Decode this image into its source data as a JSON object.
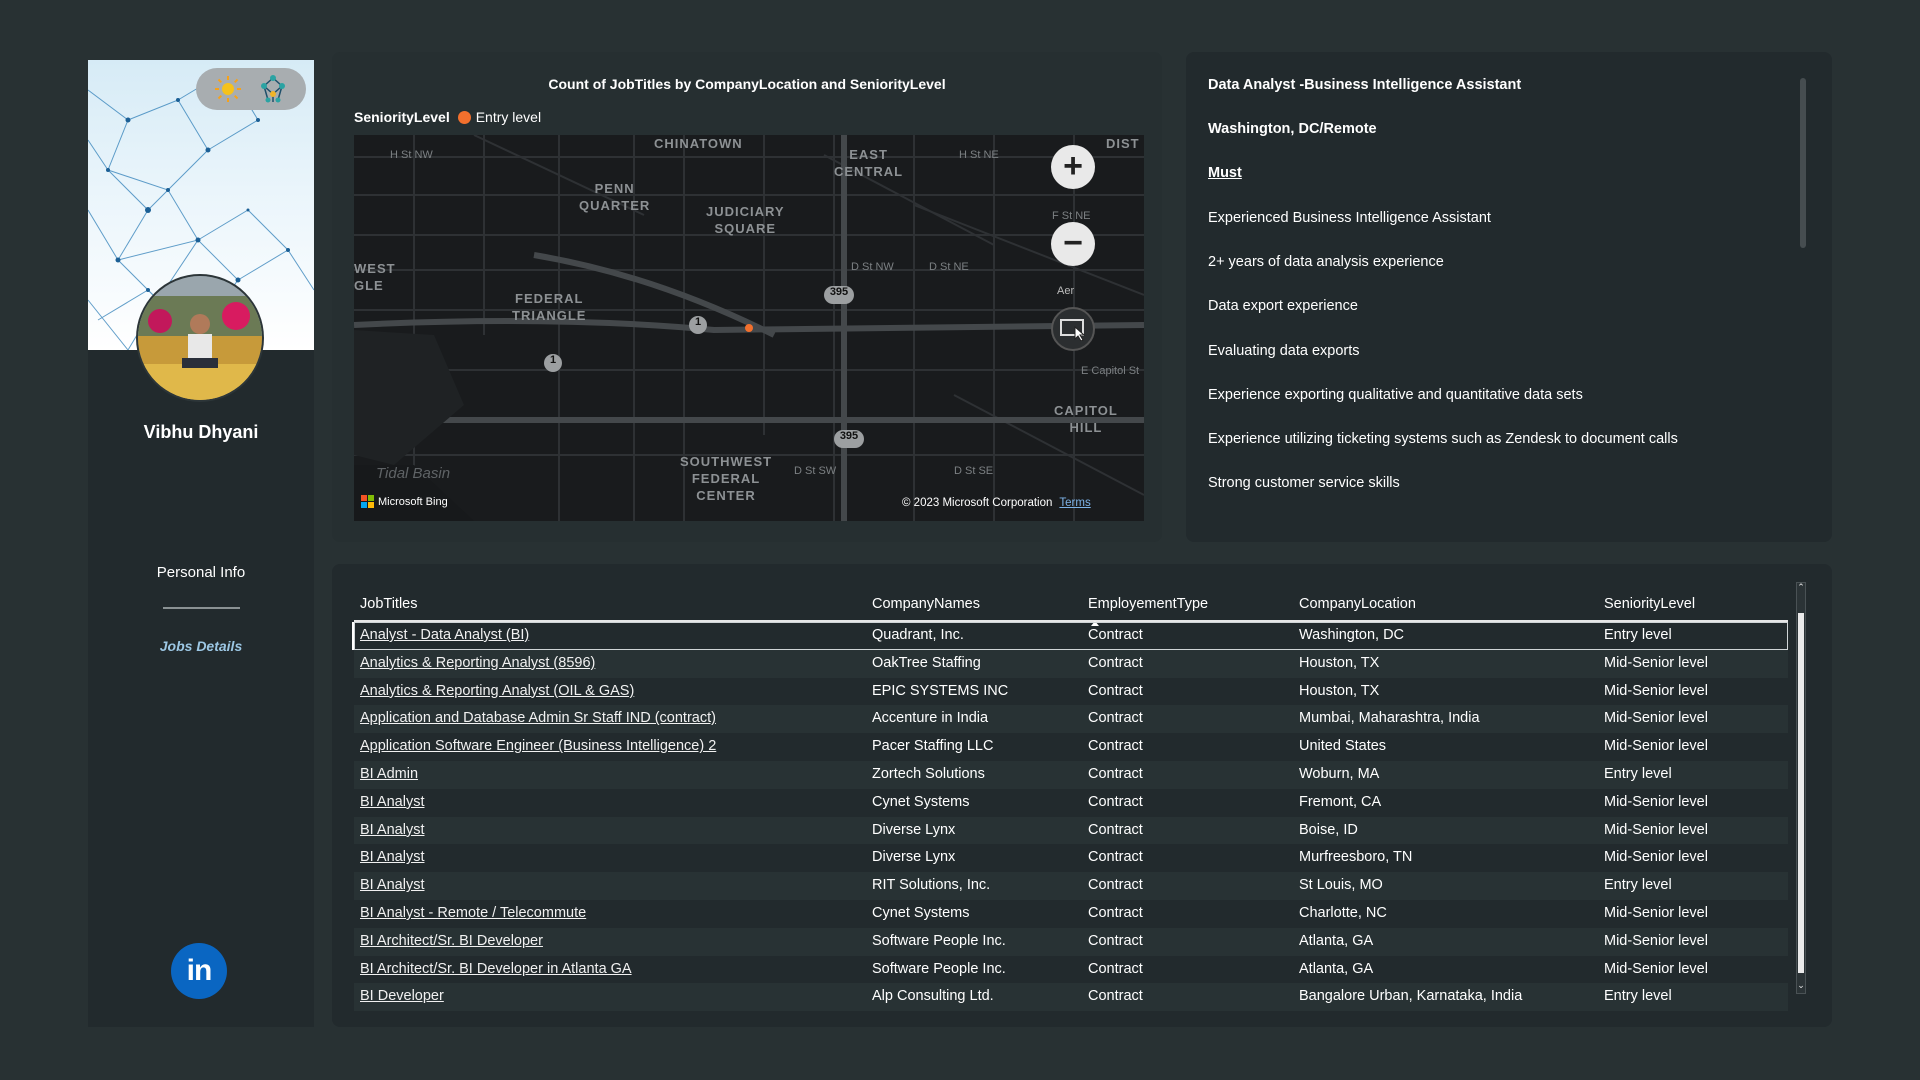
{
  "sidebar": {
    "profile_name": "Vibhu Dhyani",
    "nav": {
      "personal_info": "Personal Info",
      "jobs_details": "Jobs Details"
    },
    "linkedin_label": "in",
    "icons": [
      "sun-icon",
      "weather-network-icon",
      "linkedin-icon"
    ]
  },
  "map": {
    "title": "Count of JobTitles by CompanyLocation and SeniorityLevel",
    "legend_title": "SeniorityLevel",
    "legend_item": "Entry level",
    "legend_color": "#f3702d",
    "labels": {
      "chinatown": "CHINATOWN",
      "penn_quarter": "PENN\nQUARTER",
      "judiciary_square": "JUDICIARY\nSQUARE",
      "east_central": "EAST\nCENTRAL",
      "federal_triangle": "FEDERAL\nTRIANGLE",
      "west_gle": "WEST\nGLE",
      "capitol_hill": "CAPITOL\nHILL",
      "southwest_federal_center": "SOUTHWEST\nFEDERAL\nCENTER",
      "tidal_basin": "Tidal Basin",
      "dist": "DIST",
      "h_st_nw": "H St NW",
      "h_st_ne": "H St NE",
      "f_st_ne": "F St NE",
      "d_st_nw": "D St NW",
      "d_st_ne": "D St NE",
      "d_st_sw": "D St SW",
      "d_st_se": "D St SE",
      "e_capitol_st": "E Capitol St",
      "shield_1": "1",
      "shield_395": "395"
    },
    "zoom_in": "+",
    "zoom_out": "−",
    "aerial_label": "Aer",
    "attribution": "Microsoft Bing",
    "copyright": "© 2023 Microsoft Corporation",
    "terms": "Terms"
  },
  "description": {
    "lines": [
      "Data Analyst -Business Intelligence Assistant",
      "Washington, DC/Remote",
      "Must",
      "Experienced Business Intelligence Assistant",
      "2+ years of data analysis experience",
      "Data export experience",
      "Evaluating data exports",
      "Experience exporting qualitative and quantitative data sets",
      "Experience utilizing ticketing systems such as Zendesk to document calls",
      "Strong customer service skills"
    ]
  },
  "table": {
    "headers": [
      "JobTitles",
      "CompanyNames",
      "EmployementType",
      "CompanyLocation",
      "SeniorityLevel"
    ],
    "sorted_column": "EmployementType",
    "rows": [
      [
        "Analyst - Data Analyst (BI)",
        "Quadrant, Inc.",
        "Contract",
        "Washington, DC",
        "Entry level"
      ],
      [
        "Analytics & Reporting Analyst (8596)",
        "OakTree Staffing",
        "Contract",
        "Houston, TX",
        "Mid-Senior level"
      ],
      [
        "Analytics & Reporting Analyst (OIL & GAS)",
        "EPIC SYSTEMS INC",
        "Contract",
        "Houston, TX",
        "Mid-Senior level"
      ],
      [
        "Application and Database Admin Sr Staff IND (contract)",
        "Accenture in India",
        "Contract",
        "Mumbai, Maharashtra, India",
        "Mid-Senior level"
      ],
      [
        "Application Software Engineer (Business Intelligence) 2",
        "Pacer Staffing LLC",
        "Contract",
        "United States",
        "Mid-Senior level"
      ],
      [
        "BI Admin",
        "Zortech Solutions",
        "Contract",
        "Woburn, MA",
        "Entry level"
      ],
      [
        "BI Analyst",
        "Cynet Systems",
        "Contract",
        "Fremont, CA",
        "Mid-Senior level"
      ],
      [
        "BI Analyst",
        "Diverse Lynx",
        "Contract",
        "Boise, ID",
        "Mid-Senior level"
      ],
      [
        "BI Analyst",
        "Diverse Lynx",
        "Contract",
        "Murfreesboro, TN",
        "Mid-Senior level"
      ],
      [
        "BI Analyst",
        "RIT Solutions, Inc.",
        "Contract",
        "St Louis, MO",
        "Entry level"
      ],
      [
        "BI Analyst - Remote / Telecommute",
        "Cynet Systems",
        "Contract",
        "Charlotte, NC",
        "Mid-Senior level"
      ],
      [
        "BI Architect/Sr. BI Developer",
        "Software People Inc.",
        "Contract",
        "Atlanta, GA",
        "Mid-Senior level"
      ],
      [
        "BI Architect/Sr. BI Developer in Atlanta GA",
        "Software People Inc.",
        "Contract",
        "Atlanta, GA",
        "Mid-Senior level"
      ],
      [
        "BI Developer",
        "Alp Consulting Ltd.",
        "Contract",
        "Bangalore Urban, Karnataka, India",
        "Entry level"
      ]
    ]
  }
}
